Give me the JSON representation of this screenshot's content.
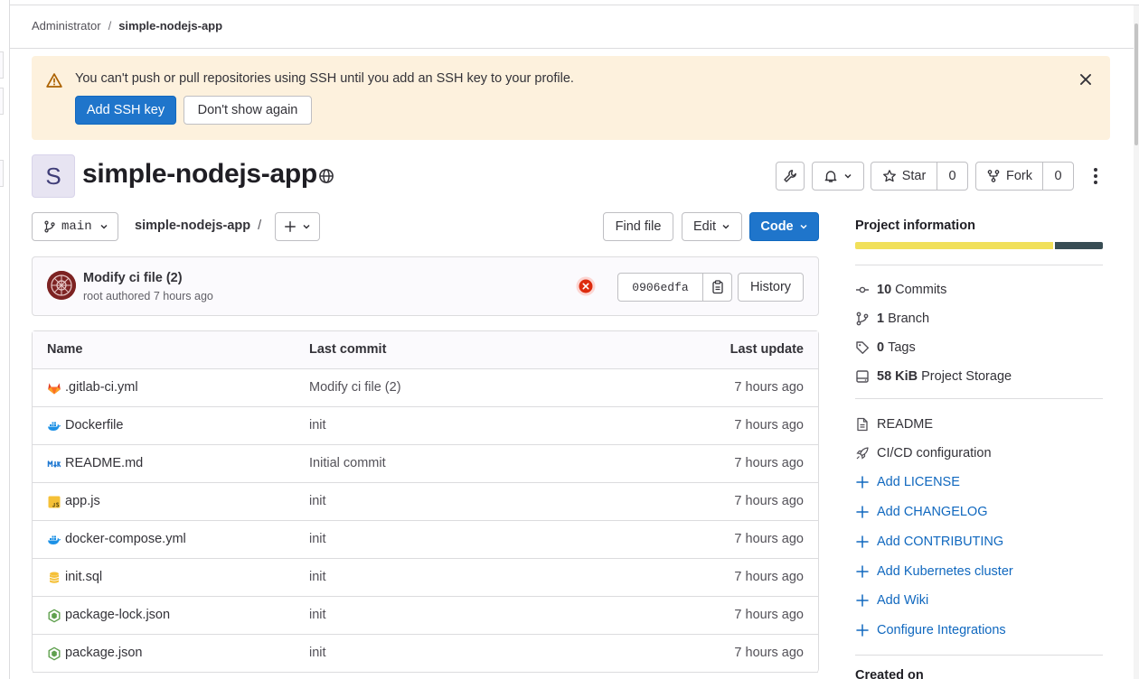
{
  "breadcrumb": {
    "parent": "Administrator",
    "separator": "/",
    "current": "simple-nodejs-app"
  },
  "alert": {
    "message": "You can't push or pull repositories using SSH until you add an SSH key to your profile.",
    "primary_label": "Add SSH key",
    "secondary_label": "Don't show again"
  },
  "project": {
    "avatar_letter": "S",
    "name": "simple-nodejs-app",
    "visibility_icon": "globe-icon",
    "star_label": "Star",
    "star_count": "0",
    "fork_label": "Fork",
    "fork_count": "0"
  },
  "toolbar": {
    "branch": "main",
    "path_root": "simple-nodejs-app",
    "path_sep": "/",
    "find_file": "Find file",
    "edit": "Edit",
    "code": "Code"
  },
  "last_commit": {
    "title": "Modify ci file (2)",
    "subtitle": "root authored 7 hours ago",
    "pipeline_status": "failed",
    "sha": "0906edfa",
    "history": "History"
  },
  "files": {
    "headers": {
      "name": "Name",
      "last_commit": "Last commit",
      "last_update": "Last update"
    },
    "rows": [
      {
        "icon": "gitlab-icon",
        "name": ".gitlab-ci.yml",
        "commit": "Modify ci file (2)",
        "updated": "7 hours ago"
      },
      {
        "icon": "docker-icon",
        "name": "Dockerfile",
        "commit": "init",
        "updated": "7 hours ago"
      },
      {
        "icon": "markdown-icon",
        "name": "README.md",
        "commit": "Initial commit",
        "updated": "7 hours ago"
      },
      {
        "icon": "javascript-icon",
        "name": "app.js",
        "commit": "init",
        "updated": "7 hours ago"
      },
      {
        "icon": "docker-icon",
        "name": "docker-compose.yml",
        "commit": "init",
        "updated": "7 hours ago"
      },
      {
        "icon": "database-icon",
        "name": "init.sql",
        "commit": "init",
        "updated": "7 hours ago"
      },
      {
        "icon": "nodejs-icon",
        "name": "package-lock.json",
        "commit": "init",
        "updated": "7 hours ago"
      },
      {
        "icon": "nodejs-icon",
        "name": "package.json",
        "commit": "init",
        "updated": "7 hours ago"
      }
    ]
  },
  "sidebar": {
    "title": "Project information",
    "languages": [
      {
        "color": "#f1e05a",
        "share": 0.805
      },
      {
        "color": "#384d54",
        "share": 0.195
      }
    ],
    "stats": [
      {
        "icon": "commit-icon",
        "value": "10",
        "label": "Commits"
      },
      {
        "icon": "branch-icon",
        "value": "1",
        "label": "Branch"
      },
      {
        "icon": "tag-icon",
        "value": "0",
        "label": "Tags"
      },
      {
        "icon": "storage-icon",
        "value": "58 KiB",
        "label": "Project Storage"
      }
    ],
    "links": [
      {
        "icon": "document-icon",
        "label": "README",
        "type": "file"
      },
      {
        "icon": "rocket-icon",
        "label": "CI/CD configuration",
        "type": "file"
      },
      {
        "icon": "plus-icon",
        "label": "Add LICENSE",
        "type": "add"
      },
      {
        "icon": "plus-icon",
        "label": "Add CHANGELOG",
        "type": "add"
      },
      {
        "icon": "plus-icon",
        "label": "Add CONTRIBUTING",
        "type": "add"
      },
      {
        "icon": "plus-icon",
        "label": "Add Kubernetes cluster",
        "type": "add"
      },
      {
        "icon": "plus-icon",
        "label": "Add Wiki",
        "type": "add"
      },
      {
        "icon": "plus-icon",
        "label": "Configure Integrations",
        "type": "add"
      }
    ],
    "footer_heading": "Created on"
  },
  "colors": {
    "primary": "#1f75cb",
    "alert_bg": "#fdf1dd",
    "link": "#1068bf",
    "danger": "#dd2b0e"
  }
}
